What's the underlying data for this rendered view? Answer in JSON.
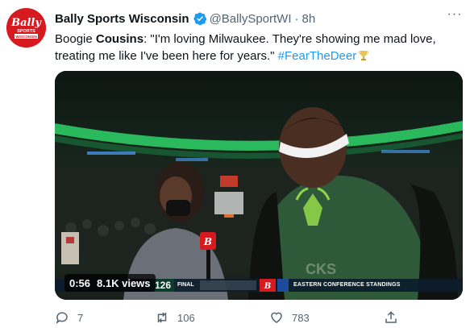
{
  "tweet": {
    "author_name": "Bally Sports Wisconsin",
    "handle": "@BallySportWI",
    "separator": "·",
    "time": "8h",
    "more_label": "···",
    "text_part1": "Boogie ",
    "text_bold": "Cousins",
    "text_part2": ": \"I'm loving Milwaukee. They're showing me mad love, treating me like I've been here for years.\" ",
    "hashtag": "#FearTheDeer",
    "avatar_logo": {
      "line1": "Bally",
      "line2": "SPORTS",
      "line3": "WISCONSIN"
    }
  },
  "video": {
    "duration": "0:56",
    "views": "8.1K views",
    "score": "126",
    "final_label": "FINAL",
    "standings_label": "EASTERN CONFERENCE STANDINGS",
    "shirt_text": "CKS"
  },
  "actions": {
    "reply_count": "7",
    "retweet_count": "106",
    "like_count": "783"
  },
  "colors": {
    "link_blue": "#1d9bf0",
    "secondary_text": "#536471",
    "brand_red": "#d71920",
    "bucks_green": "#2e5a3a"
  }
}
